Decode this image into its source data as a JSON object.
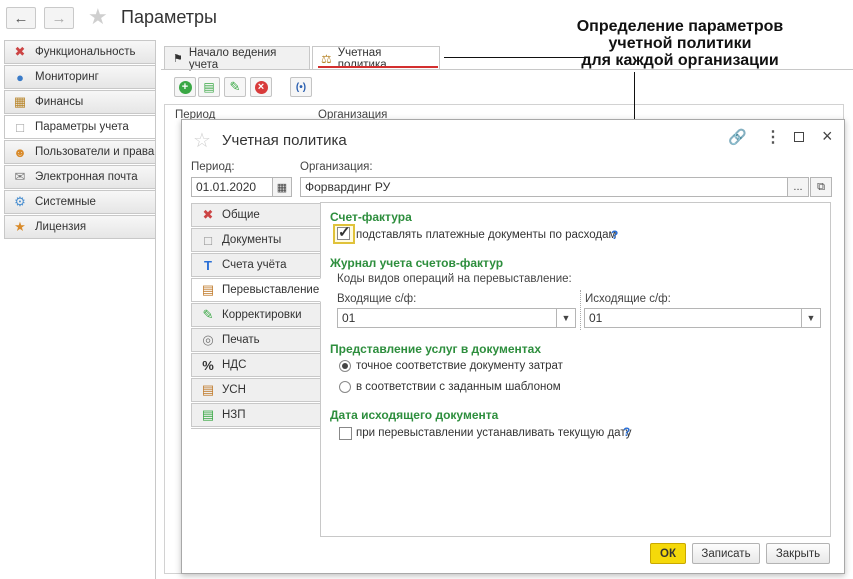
{
  "app": {
    "title": "Параметры"
  },
  "sidebar": {
    "items": [
      {
        "label": "Функциональность",
        "icon": "tools-icon"
      },
      {
        "label": "Мониторинг",
        "icon": "globe-icon"
      },
      {
        "label": "Финансы",
        "icon": "finance-icon"
      },
      {
        "label": "Параметры учета",
        "icon": "page-icon"
      },
      {
        "label": "Пользователи и права",
        "icon": "users-icon"
      },
      {
        "label": "Электронная почта",
        "icon": "mail-icon"
      },
      {
        "label": "Системные",
        "icon": "system-icon"
      },
      {
        "label": "Лицензия",
        "icon": "license-icon"
      }
    ]
  },
  "tabs": [
    {
      "label": "Начало ведения учета"
    },
    {
      "label": "Учетная политика"
    }
  ],
  "behind_table": {
    "col_period": "Период",
    "col_org": "Организация"
  },
  "callout": {
    "lines": [
      "Определение параметров",
      "учетной политики",
      "для каждой организации"
    ]
  },
  "dialog": {
    "title": "Учетная политика",
    "period_label": "Период:",
    "period_value": "01.01.2020",
    "org_label": "Организация:",
    "org_value": "Форвардинг РУ",
    "org_select_btn": "...",
    "vtabs": [
      {
        "label": "Общие",
        "icon": "tools-icon"
      },
      {
        "label": "Документы",
        "icon": "document-icon"
      },
      {
        "label": "Счета учёта",
        "icon": "accounts-icon"
      },
      {
        "label": "Перевыставление",
        "icon": "reissue-icon"
      },
      {
        "label": "Корректировки",
        "icon": "pencil-icon"
      },
      {
        "label": "Печать",
        "icon": "print-icon"
      },
      {
        "label": "НДС",
        "icon": "percent-icon"
      },
      {
        "label": "УСН",
        "icon": "usn-icon"
      },
      {
        "label": "НЗП",
        "icon": "nzp-icon"
      }
    ],
    "invoice_section": {
      "title": "Счет-фактура",
      "checkbox_label": "подставлять платежные документы по расходам",
      "checked": true,
      "help": "?"
    },
    "journal_section": {
      "title": "Журнал учета счетов-фактур",
      "subtitle": "Коды видов операций на перевыставление:",
      "incoming_label": "Входящие с/ф:",
      "incoming_value": "01",
      "outgoing_label": "Исходящие с/ф:",
      "outgoing_value": "01"
    },
    "services_section": {
      "title": "Представление услуг в документах",
      "options": [
        {
          "label": "точное соответствие документу затрат",
          "selected": true
        },
        {
          "label": "в соответствии с заданным шаблоном",
          "selected": false
        }
      ]
    },
    "date_section": {
      "title": "Дата исходящего документа",
      "checkbox_label": "при перевыставлении устанавливать текущую дату",
      "checked": false,
      "help": "?"
    },
    "buttons": {
      "ok": "ОК",
      "save": "Записать",
      "close": "Закрыть"
    }
  },
  "colors": {
    "accent_green": "#2d8e3d",
    "ok_yellow": "#f5d90a",
    "underline_red": "#d32f2f"
  }
}
